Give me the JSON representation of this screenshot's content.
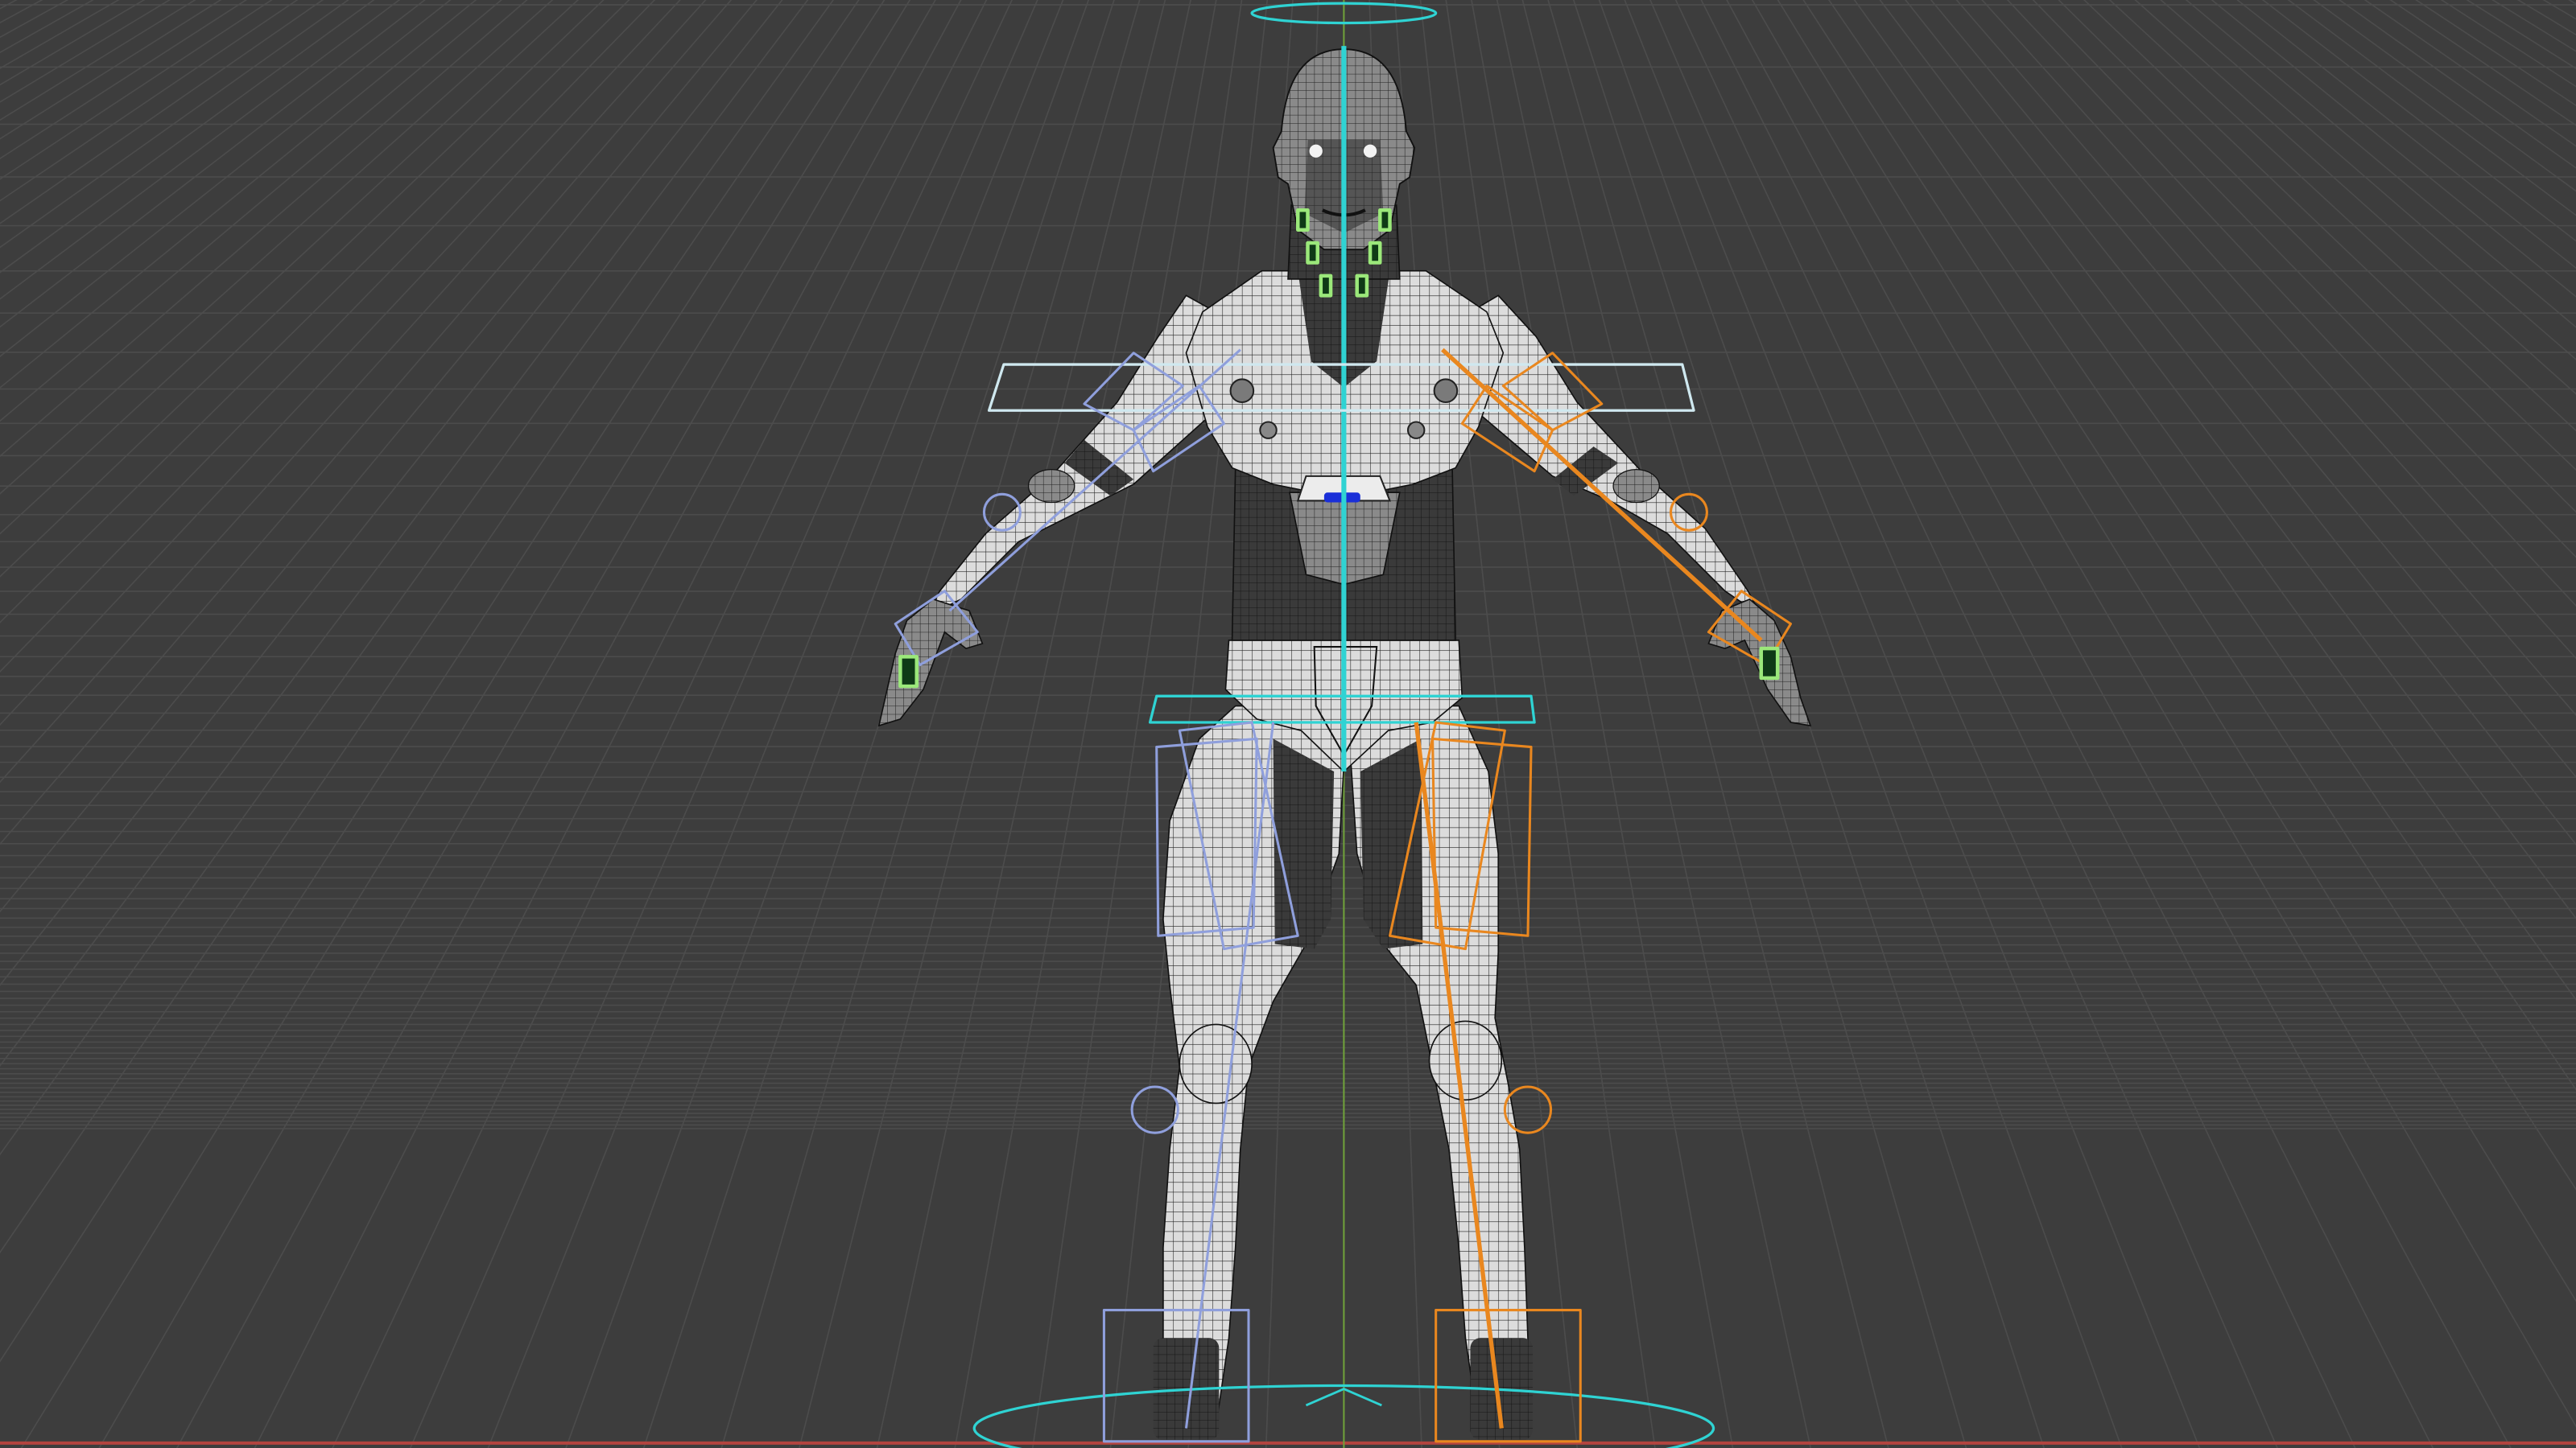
{
  "viewport": {
    "background_color": "#3d3d3d",
    "grid_color": "#4c4c4c",
    "x_axis_color": "#b3443f",
    "z_axis_color": "#6fa13a"
  },
  "rig": {
    "center_bone_color": "#2fd3d3",
    "left_side_color": "#8f9fdc",
    "right_side_color": "#e9871f",
    "face_control_color": "#9be87a",
    "mesh_fill_color": "#dcdcdc",
    "mesh_wire_color": "#1f1f1f",
    "dark_panel_color": "#3a3a3a",
    "selected_marker_color": "#1a2fd8"
  }
}
